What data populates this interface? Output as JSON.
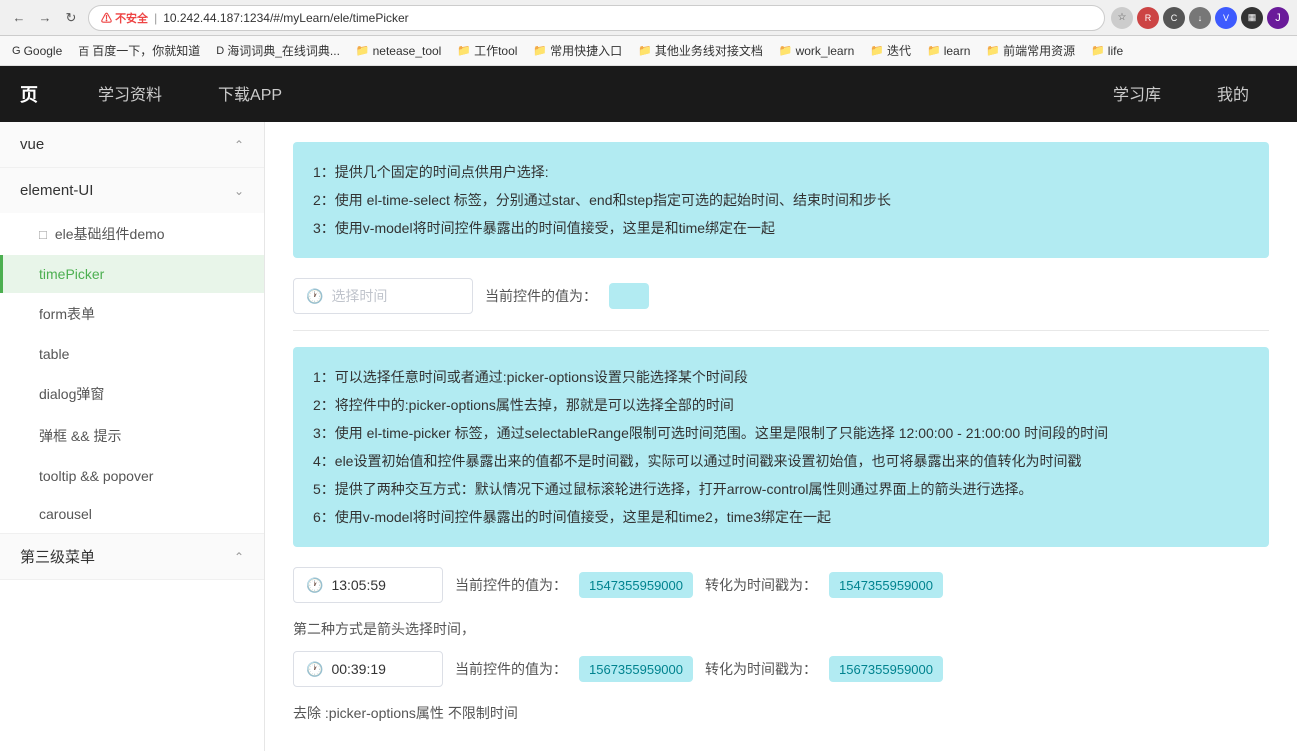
{
  "browser": {
    "url": "10.242.44.187:1234/#/myLearn/ele/timePicker",
    "warning": "不安全",
    "separator": "|"
  },
  "bookmarks": [
    {
      "id": "google",
      "icon": "G",
      "label": "Google"
    },
    {
      "id": "baidu",
      "icon": "百",
      "label": "百度一下，你就知道"
    },
    {
      "id": "cidian",
      "icon": "D",
      "label": "海词词典_在线词典..."
    },
    {
      "id": "netease",
      "icon": "📁",
      "label": "netease_tool"
    },
    {
      "id": "tool",
      "icon": "📁",
      "label": "工作tool"
    },
    {
      "id": "kuaijie",
      "icon": "📁",
      "label": "常用快捷入口"
    },
    {
      "id": "other",
      "icon": "📁",
      "label": "其他业务线对接文档"
    },
    {
      "id": "work_learn",
      "icon": "📁",
      "label": "work_learn"
    },
    {
      "id": "dai",
      "icon": "📁",
      "label": "迭代"
    },
    {
      "id": "learn",
      "icon": "📁",
      "label": "learn"
    },
    {
      "id": "qianduan",
      "icon": "📁",
      "label": "前端常用资源"
    },
    {
      "id": "life",
      "icon": "📁",
      "label": "life"
    }
  ],
  "topNav": {
    "logo": "页",
    "items": [
      {
        "id": "xuexiziliao",
        "label": "学习资料",
        "active": false
      },
      {
        "id": "xiazai",
        "label": "下载APP",
        "active": false
      },
      {
        "id": "xuexiku",
        "label": "学习库",
        "active": false
      },
      {
        "id": "wode",
        "label": "我的",
        "active": false
      }
    ]
  },
  "sidebar": {
    "sections": [
      {
        "id": "vue",
        "label": "vue",
        "expanded": true,
        "children": []
      },
      {
        "id": "element-ui",
        "label": "element-UI",
        "expanded": true,
        "children": [
          {
            "id": "ele-demo",
            "label": "ele基础组件demo",
            "icon": "□",
            "active": false
          },
          {
            "id": "timePicker",
            "label": "timePicker",
            "active": true
          },
          {
            "id": "form",
            "label": "form表单",
            "active": false
          },
          {
            "id": "table",
            "label": "table",
            "active": false
          },
          {
            "id": "dialog",
            "label": "dialog弹窗",
            "active": false
          },
          {
            "id": "popover",
            "label": "弹框 && 提示",
            "active": false
          },
          {
            "id": "tooltip",
            "label": "tooltip && popover",
            "active": false
          },
          {
            "id": "carousel",
            "label": "carousel",
            "active": false
          }
        ]
      },
      {
        "id": "level3",
        "label": "第三级菜单",
        "expanded": true,
        "children": []
      }
    ]
  },
  "content": {
    "infoBox1": {
      "lines": [
        "1：提供几个固定的时间点供用户选择:",
        "2：使用 el-time-select 标签，分别通过star、end和step指定可选的起始时间、结束时间和步长",
        "3：使用v-model将时间控件暴露出的时间值接受，这里是和time绑定在一起"
      ]
    },
    "demo1": {
      "inputPlaceholder": "选择时间",
      "currentLabel": "当前控件的值为：",
      "currentValue": ""
    },
    "infoBox2": {
      "lines": [
        "1：可以选择任意时间或者通过:picker-options设置只能选择某个时间段",
        "2：将控件中的:picker-options属性去掉，那就是可以选择全部的时间",
        "3：使用 el-time-picker 标签，通过selectableRange限制可选时间范围。这里是限制了只能选择 12:00:00 - 21:00:00 时间段的时间",
        "4：ele设置初始值和控件暴露出来的值都不是时间戳，实际可以通过时间戳来设置初始值，也可将暴露出来的值转化为时间戳",
        "5：提供了两种交互方式：默认情况下通过鼠标滚轮进行选择，打开arrow-control属性则通过界面上的箭头进行选择。",
        "6：使用v-model将时间控件暴露出的时间值接受，这里是和time2，time3绑定在一起"
      ]
    },
    "demo2": {
      "timeValue": "13:05:59",
      "currentLabel": "当前控件的值为：",
      "currentValue": "1547355959000",
      "convertLabel": "转化为时间戳为：",
      "convertValue": "1547355959000"
    },
    "secondMethod": {
      "label": "第二种方式是箭头选择时间，",
      "timeValue": "00:39:19",
      "currentLabel": "当前控件的值为：",
      "currentValue": "1567355959000",
      "convertLabel": "转化为时间戳为：",
      "convertValue": "1567355959000"
    },
    "noLimit": {
      "label": "去除 :picker-options属性 不限制时间"
    }
  }
}
